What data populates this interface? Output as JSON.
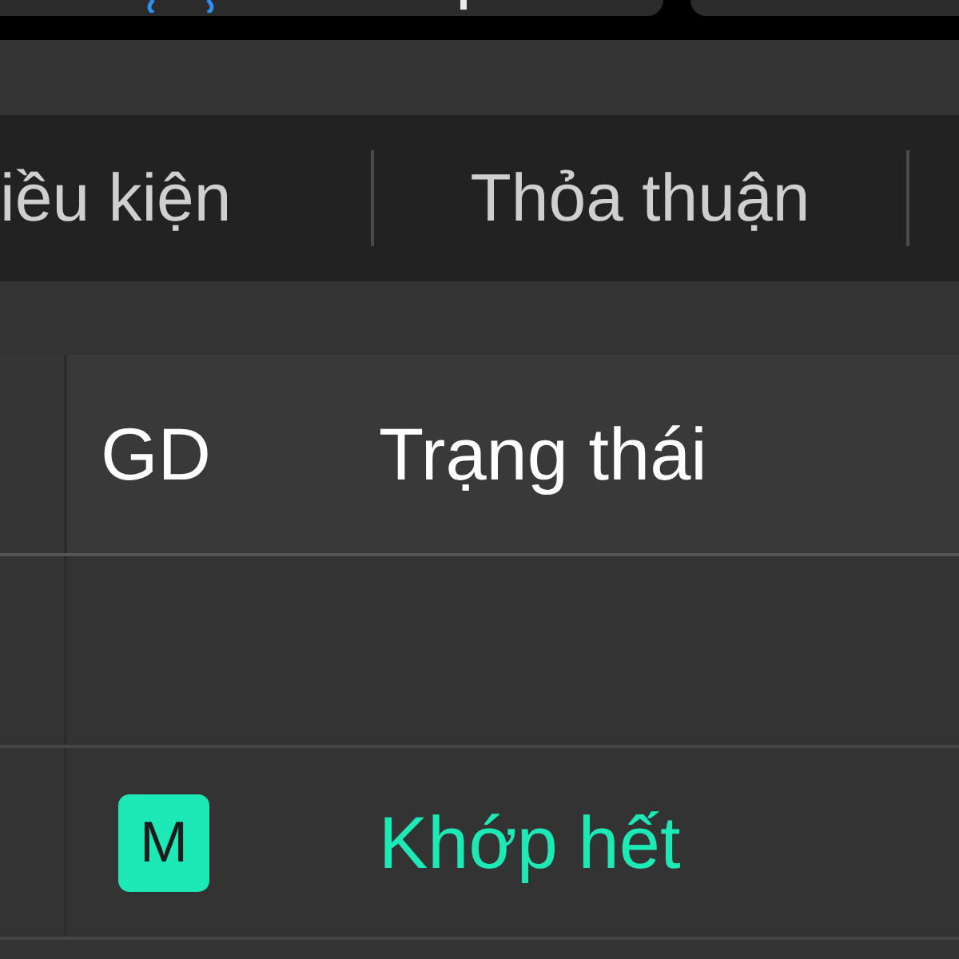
{
  "tabs": [
    {
      "label": "iều kiện",
      "selected": false
    },
    {
      "label": "Thỏa thuận",
      "selected": false
    }
  ],
  "table": {
    "columns": [
      "GD",
      "Trạng thái"
    ],
    "rows": [
      {
        "kind": "blank"
      },
      {
        "kind": "order",
        "type_badge": "M",
        "status": "Khớp hết",
        "color": "#1de9b6"
      }
    ]
  }
}
